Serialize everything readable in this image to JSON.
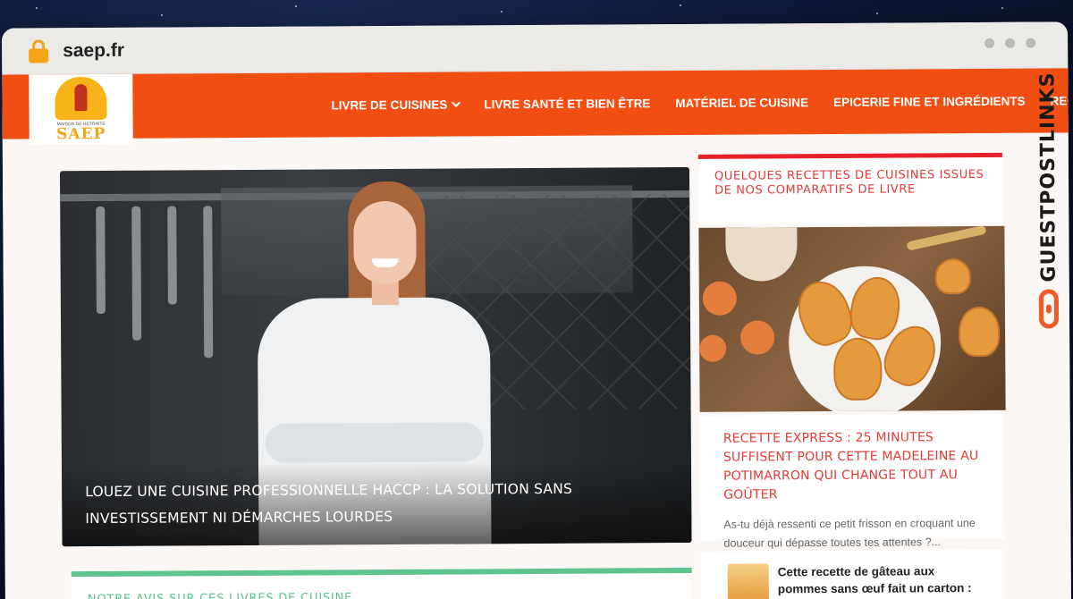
{
  "browser": {
    "url": "saep.fr"
  },
  "site": {
    "logo": {
      "tagline": "MAISON DE RETRAITE",
      "name": "SAEP"
    },
    "menu": [
      {
        "label": "LIVRE DE CUISINES",
        "has_dropdown": true
      },
      {
        "label": "LIVRE SANTÉ ET BIEN ÊTRE"
      },
      {
        "label": "MATÉRIEL DE CUISINE"
      },
      {
        "label": "EPICERIE FINE ET INGRÉDIENTS"
      },
      {
        "label": "RECETTES"
      }
    ],
    "accent_color": "#f04e12"
  },
  "hero": {
    "caption": "LOUEZ UNE CUISINE PROFESSIONNELLE HACCP : LA SOLUTION SANS INVESTISSEMENT NI DÉMARCHES LOURDES"
  },
  "books_section": {
    "title": "NOTRE AVIS SUR CES LIVRES DE CUISINE",
    "accent_color": "#5dc48e"
  },
  "sidebar": {
    "heading": "QUELQUES RECETTES DE CUISINES ISSUES DE NOS COMPARATIFS DE LIVRE",
    "featured": {
      "title": "RECETTE EXPRESS : 25 MINUTES SUFFISENT POUR CETTE MADELEINE AU POTIMARRON QUI CHANGE TOUT AU GOÛTER",
      "excerpt": "As-tu déjà ressenti ce petit frisson en croquant une douceur qui dépasse toutes tes attentes ?..."
    },
    "mini_post": {
      "title": "Cette recette de gâteau aux pommes sans œuf fait un carton : personne ne croit qu'il est aussi moelleux"
    },
    "accent_color": "#e8202c"
  },
  "watermark": {
    "text": "GUESTPOSTLINKS"
  }
}
